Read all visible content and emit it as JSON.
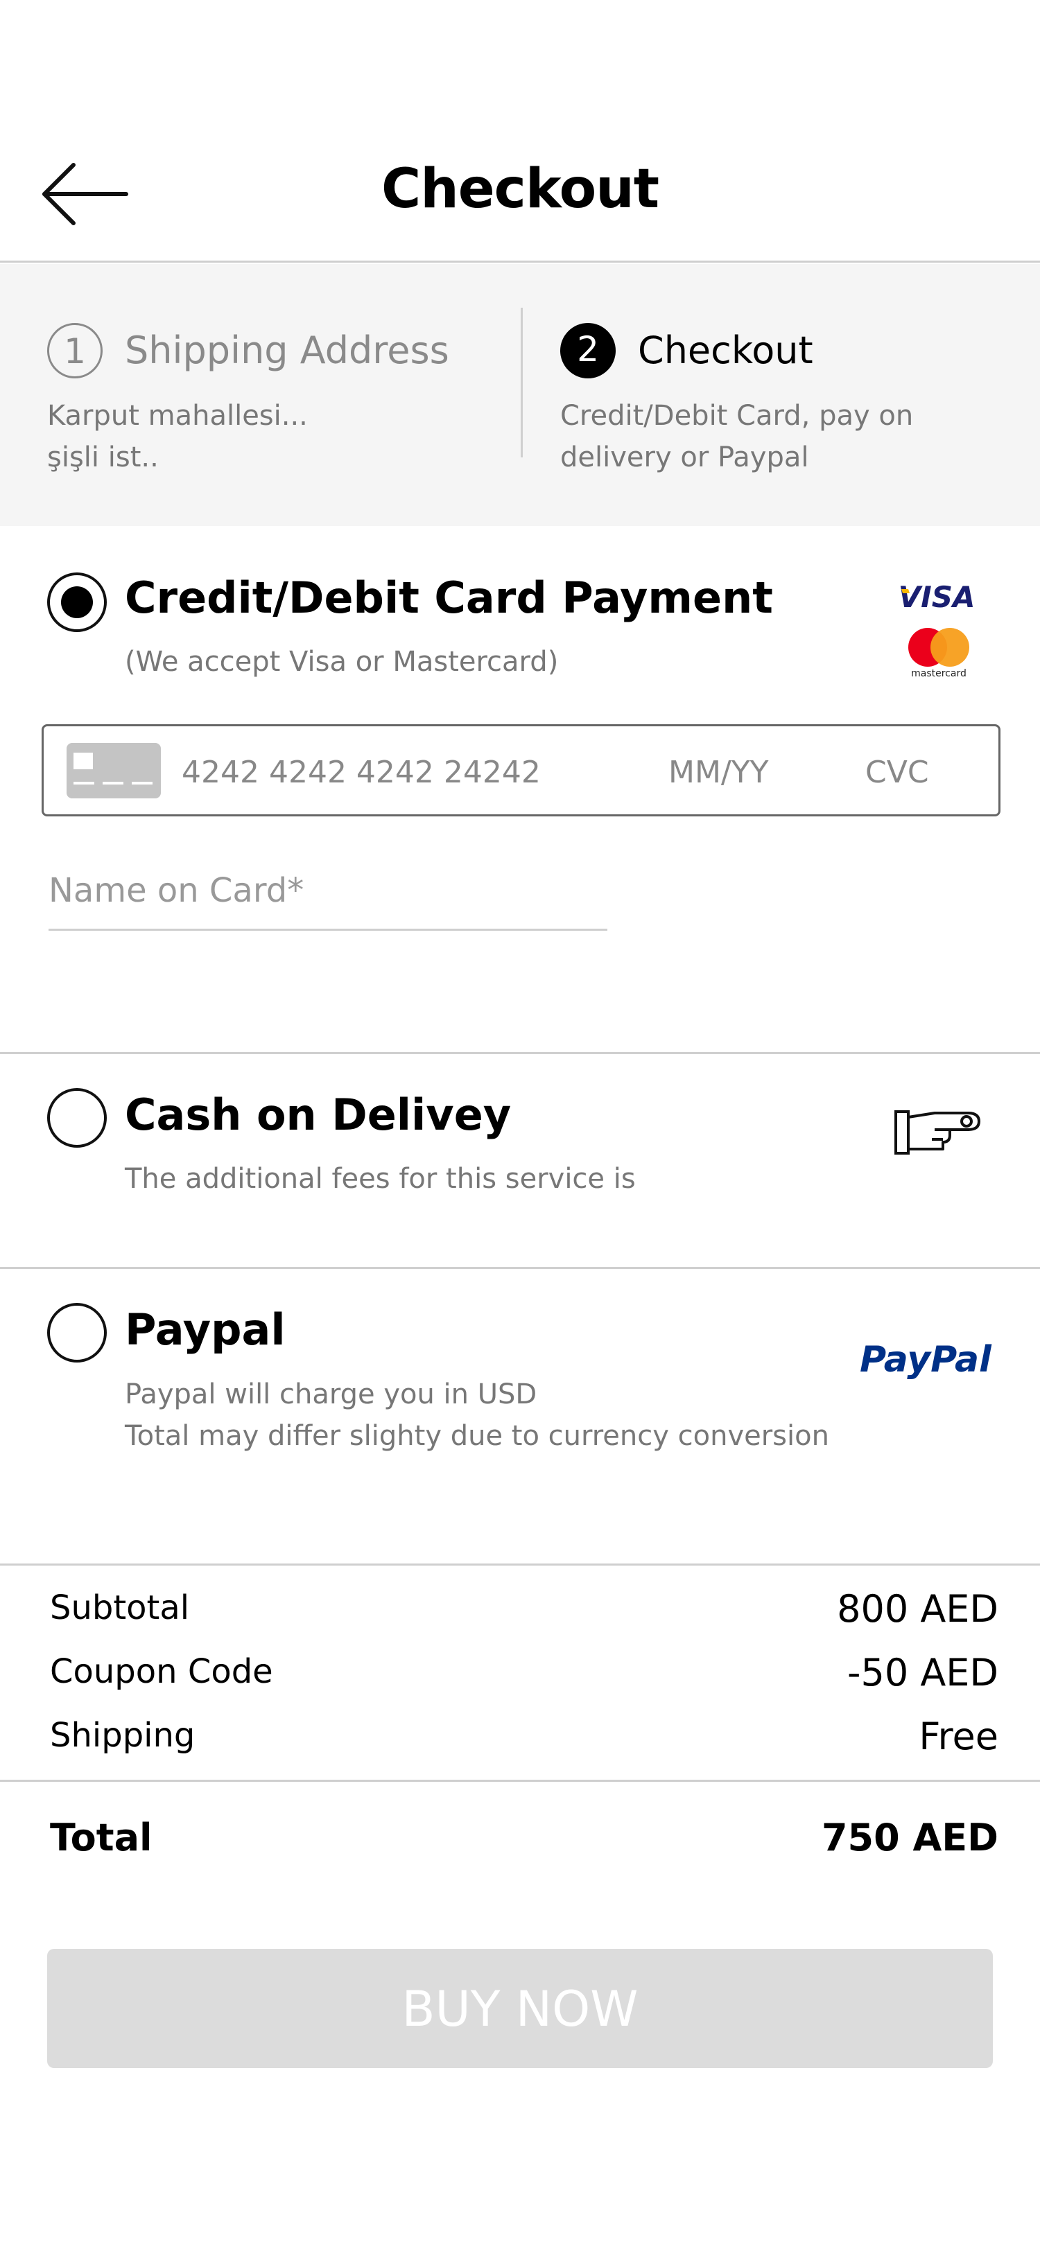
{
  "header": {
    "title": "Checkout",
    "back_icon": "arrow-left-icon"
  },
  "stepper": {
    "step1": {
      "number": "1",
      "title": "Shipping Address",
      "line1": "Karput mahallesi...",
      "line2": "şişli ist.."
    },
    "step2": {
      "number": "2",
      "title": "Checkout",
      "line1": "Credit/Debit Card, pay on",
      "line2": "delivery or Paypal"
    }
  },
  "payment_options": {
    "card": {
      "title": "Credit/Debit Card Payment",
      "subtitle": "(We accept Visa or Mastercard)",
      "selected": true,
      "visa_label": "VISA",
      "mastercard_label": "mastercard",
      "number_placeholder": "4242 4242 4242 24242",
      "expiry_placeholder": "MM/YY",
      "cvc_placeholder": "CVC",
      "name_placeholder": "Name on Card*"
    },
    "cash": {
      "title": "Cash on Delivey",
      "subtitle": "The additional fees for this service is",
      "selected": false,
      "icon": "hand-pointing-icon"
    },
    "paypal": {
      "title": "Paypal",
      "line1": "Paypal will charge you in USD",
      "line2": "Total may differ slighty due to currency conversion",
      "selected": false,
      "logo": "PayPal"
    }
  },
  "summary": {
    "subtotal_label": "Subtotal",
    "subtotal_value": "800 AED",
    "coupon_label": "Coupon Code",
    "coupon_value": "-50 AED",
    "shipping_label": "Shipping",
    "shipping_value": "Free",
    "total_label": "Total",
    "total_value": "750 AED"
  },
  "buy_button": {
    "label": "BUY NOW"
  },
  "colors": {
    "visa_blue": "#1a1f71",
    "visa_gold": "#f7b600",
    "mc_red": "#eb001b",
    "mc_orange": "#f79e1b",
    "paypal_dark": "#003087",
    "paypal_light": "#009cde"
  }
}
